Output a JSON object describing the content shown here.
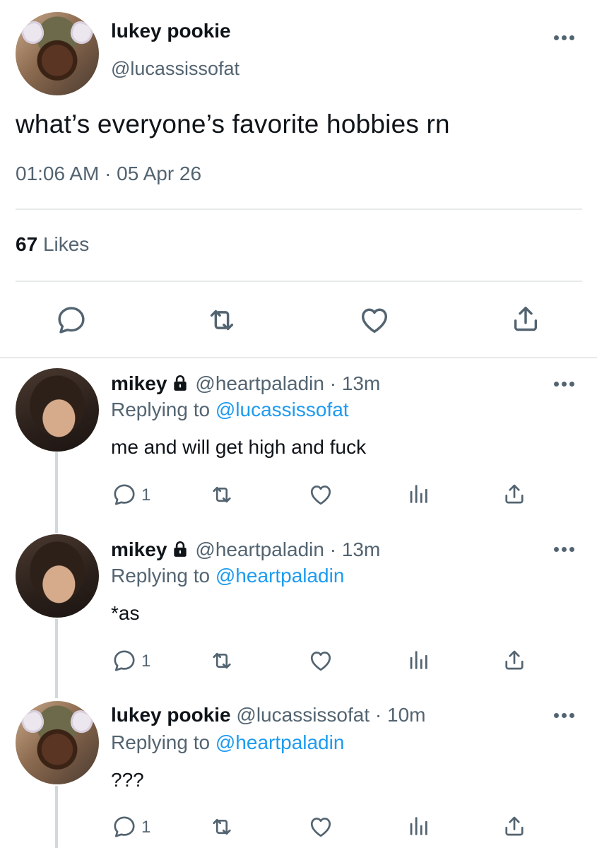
{
  "main_tweet": {
    "display_name": "lukey pookie",
    "handle": "@lucassissofat",
    "text": "what’s everyone’s favorite hobbies rn",
    "timestamp": "01:06 AM · 05 Apr 26",
    "likes_count": "67",
    "likes_label": "Likes"
  },
  "replies": [
    {
      "display_name": "mikey",
      "handle": "@heartpaladin",
      "separator": " · ",
      "time": "13m",
      "replying_label": "Replying to",
      "replying_to": "@lucassissofat",
      "text": "me and will get high and fuck",
      "reply_count": "1"
    },
    {
      "display_name": "mikey",
      "handle": "@heartpaladin",
      "separator": " · ",
      "time": "13m",
      "replying_label": "Replying to",
      "replying_to": "@heartpaladin",
      "text": "*as",
      "reply_count": "1"
    },
    {
      "display_name": "lukey pookie",
      "handle": "@lucassissofat",
      "separator": " · ",
      "time": "10m",
      "replying_label": "Replying to",
      "replying_to": "@heartpaladin",
      "text": "???",
      "reply_count": "1"
    }
  ],
  "colors": {
    "text": "#0f1419",
    "secondary": "#536471",
    "accent": "#1d9bf0",
    "divider": "#e7e9ea"
  },
  "icons": {
    "reply": "reply-icon",
    "retweet": "retweet-icon",
    "like": "heart-icon",
    "views": "views-icon",
    "share": "share-icon",
    "more": "more-icon",
    "lock": "lock-icon"
  }
}
